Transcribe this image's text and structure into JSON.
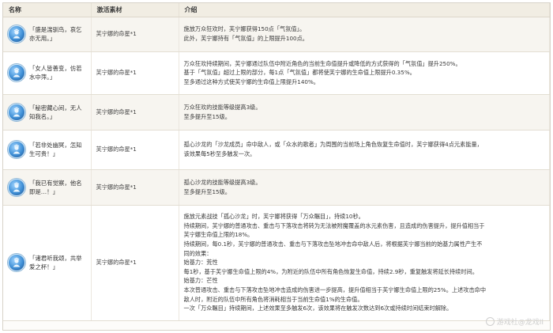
{
  "headers": {
    "name": "名称",
    "material": "激活素材",
    "intro": "介绍"
  },
  "rows": [
    {
      "name": "「盛是湍驯鸟，哀乞亦无用。」",
      "material": "芙宁娜的命星*1",
      "desc": [
        "施放万众狂欢时，芙宁娜获得150点「气氛值」。",
        "此外，芙宁娜持有「气氛值」的上限提升100点。"
      ]
    },
    {
      "name": "「女人皆善变，仿若水中萍。」",
      "material": "芙宁娜的命星*1",
      "desc": [
        "万众狂欢持续期间，芙宁娜通过队伍中附近角色的当前生命值提升或降低的方式获得的「气氛值」提升250%。",
        "基于「气氛值」超过上限的部分，每1点「气氛值」都将使芙宁娜的生命值上限提升0.35%。",
        "至多通过这种方式使芙宁娜的生命值上限提升140%。"
      ]
    },
    {
      "name": "「秘密藏心间，无人知我名。」",
      "material": "芙宁娜的命星*1",
      "desc": [
        "万众狂欢的技能等级提高3级。",
        "至多提升至15级。"
      ]
    },
    {
      "name": "「若非处幽冥，怎知生可贵！」",
      "material": "芙宁娜的命星*1",
      "desc": [
        "孤心沙龙的「沙龙成员」命中敌人，或「众水的歌者」为周围的当前场上角色恢复生命值时，芙宁娜获得4点元素能量，",
        "该效果每5秒至多触发一次。"
      ]
    },
    {
      "name": "「我已有觉察，他名即是…！」",
      "material": "芙宁娜的命星*1",
      "desc": [
        "孤心沙龙的技能等级提高3级。",
        "至多提升至15级。"
      ]
    },
    {
      "name": "「诸君听我颂，共举爱之杯！」",
      "material": "芙宁娜的命星*1",
      "desc": [
        "施放元素战技「孤心沙龙」时，芙宁娜将获得「万众瞩目」，持续10秒。",
        "持续期间，芙宁娜的普通攻击、重击与下落攻击将转为无法被附魔覆盖的水元素伤害，且造成的伤害提升，提升值相当于",
        "芙宁娜生命值上限的18%。",
        "持续期间，每0.1秒，芙宁娜的普通攻击、重击与下落攻击坠地冲击命中敌人后，将根据芙宁娜当前的始基力属性产生不",
        "同的效果：",
        "始基力：荒性",
        "每1秒，基于芙宁娜生命值上限的4%，为附近的队伍中所有角色恢复生命值，持续2.9秒，重复触发将延长持续时间。",
        "始基力：芒性",
        "本次普通攻击、重击与下落攻击坠地冲击造成的伤害进一步提高，提升值相当于芙宁娜生命值上限的25%。上述攻击命中",
        "敌人时，附近的队伍中所有角色将消耗相当于当前生命值1%的生命值。",
        "一次「万众瞩目」持续期间，上述效果至多触发6次，该效果将在触发次数达到6次或持续时间结束时解除。"
      ]
    }
  ],
  "watermark": "游戏社@龙戏II"
}
